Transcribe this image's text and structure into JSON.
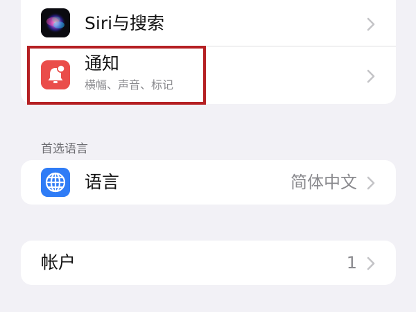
{
  "settings": {
    "siri_row": {
      "label": "Siri与搜索",
      "icon": "siri-icon"
    },
    "notifications_row": {
      "label": "通知",
      "subtitle": "横幅、声音、标记",
      "icon": "bell-icon",
      "icon_color": "#ea4d4a"
    },
    "preferred_language": {
      "header": "首选语言",
      "row": {
        "label": "语言",
        "value": "简体中文",
        "icon": "globe-icon",
        "icon_color": "#2f7cf6"
      }
    },
    "accounts_row": {
      "label": "帐户",
      "value": "1"
    }
  },
  "annotation": {
    "highlight_color": "#b52023",
    "target": "notifications_row"
  },
  "colors": {
    "background": "#f2f1f6",
    "card": "#ffffff",
    "secondary_text": "#8a8a8e",
    "chevron": "#c4c4c7"
  }
}
